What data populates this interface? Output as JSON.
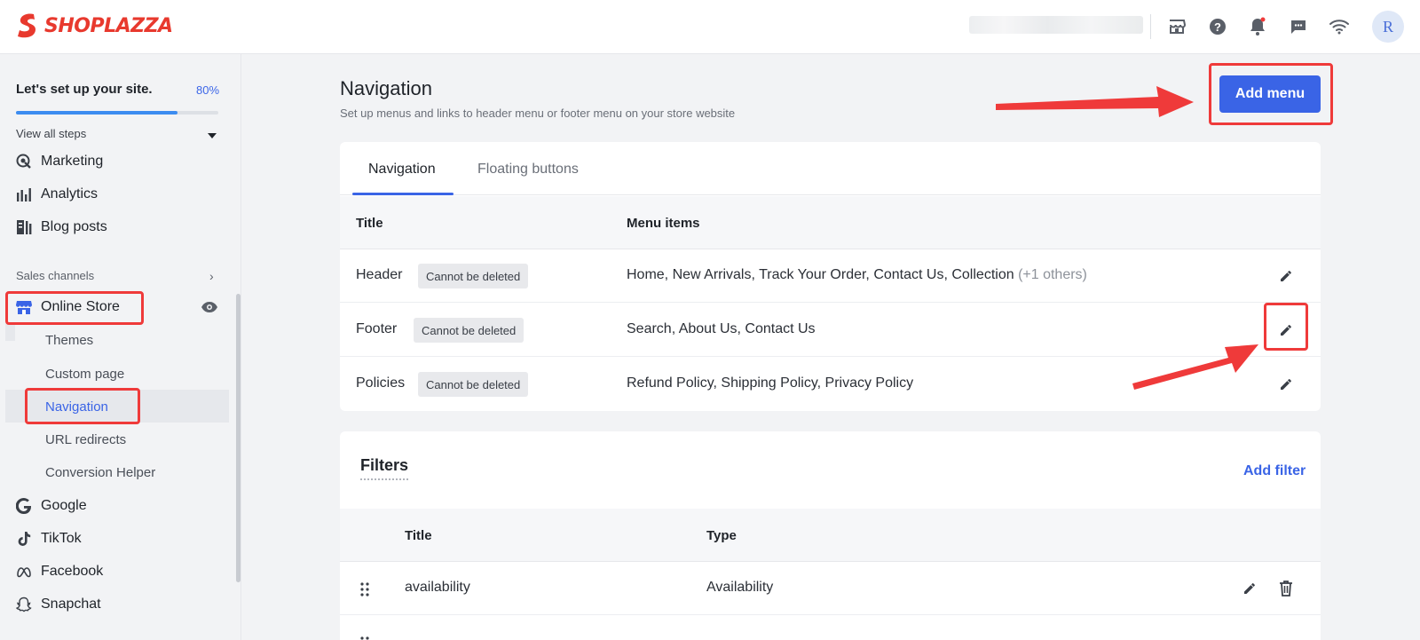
{
  "brand": {
    "name": "SHOPLAZZA",
    "color": "#e8392e",
    "accent": "#3a64e6"
  },
  "topbar": {
    "icons": [
      "store-icon",
      "help-icon",
      "bell-icon",
      "chat-icon",
      "wifi-icon"
    ],
    "avatar_initial": "R"
  },
  "sidebar": {
    "setup_title": "Let's set up your site.",
    "setup_percent": "80%",
    "setup_progress": 0.8,
    "view_all_steps": "View all steps",
    "items": [
      {
        "label": "Marketing",
        "icon": "marketing-icon"
      },
      {
        "label": "Analytics",
        "icon": "analytics-icon"
      },
      {
        "label": "Blog posts",
        "icon": "blog-icon"
      }
    ],
    "sales_channels_label": "Sales channels",
    "online_store": "Online Store",
    "sub_items": [
      "Themes",
      "Custom page",
      "Navigation",
      "URL redirects",
      "Conversion Helper"
    ],
    "channels": [
      "Google",
      "TikTok",
      "Facebook",
      "Snapchat"
    ]
  },
  "main": {
    "title": "Navigation",
    "description": "Set up menus and links to header menu or footer menu on your store website",
    "add_menu_label": "Add menu",
    "tabs": [
      "Navigation",
      "Floating buttons"
    ],
    "menu_table": {
      "headers": [
        "Title",
        "Menu items"
      ],
      "rows": [
        {
          "title": "Header",
          "badge": "Cannot be deleted",
          "items": "Home, New Arrivals, Track Your Order, Contact Us, Collection",
          "extra": "(+1 others)"
        },
        {
          "title": "Footer",
          "badge": "Cannot be deleted",
          "items": "Search, About Us, Contact Us",
          "extra": ""
        },
        {
          "title": "Policies",
          "badge": "Cannot be deleted",
          "items": "Refund Policy, Shipping Policy, Privacy Policy",
          "extra": ""
        }
      ]
    },
    "filters": {
      "title": "Filters",
      "add_filter_label": "Add filter",
      "headers": [
        "Title",
        "Type"
      ],
      "rows": [
        {
          "title": "availability",
          "type": "Availability"
        }
      ]
    }
  },
  "annotation_color": "#ef3a3a"
}
